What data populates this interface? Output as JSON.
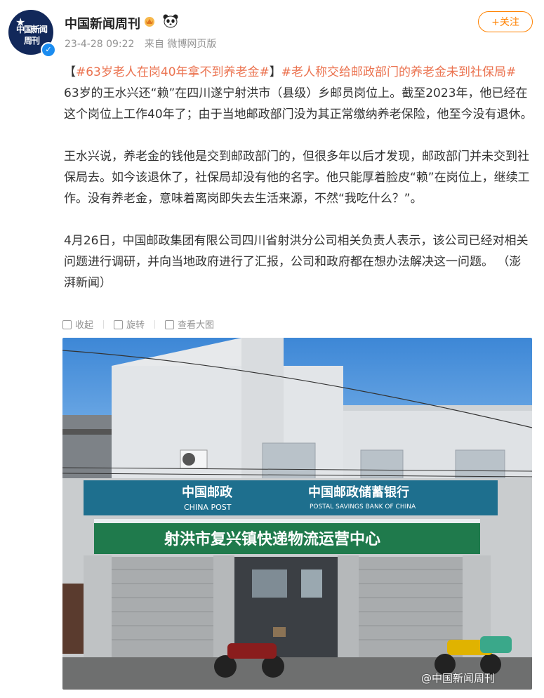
{
  "account": {
    "name": "中国新闻周刊",
    "avatar_text": "中国新闻周刊",
    "verified_icon": "verified-badge-icon"
  },
  "post_meta": {
    "date": "23-4-28 09:22",
    "source": "来自 微博网页版"
  },
  "follow_label": "+关注",
  "post": {
    "tag1": "#63岁老人在岗40年拿不到养老金#",
    "tag2": "#老人称交给邮政部门的养老金未到社保局#",
    "p1": " 63岁的王水兴还“赖”在四川遂宁射洪市（县级）乡邮员岗位上。截至2023年，他已经在这个岗位上工作40年了；由于当地邮政部门没为其正常缴纳养老保险，他至今没有退休。",
    "p2": "王水兴说，养老金的钱他是交到邮政部门的，但很多年以后才发现，邮政部门并未交到社保局去。如今该退休了，社保局却没有他的名字。他只能厚着脸皮“赖”在岗位上，继续工作。没有养老金，意味着离岗即失去生活来源，不然“我吃什么？”。",
    "p3": "4月26日，中国邮政集团有限公司四川省射洪分公司相关负责人表示，该公司已经对相关问题进行调研，并向当地政府进行了汇报，公司和政府都在想办法解决这一问题。 （澎湃新闻）"
  },
  "tools": {
    "collapse": "收起",
    "rotate": "旋转",
    "view_large": "查看大图"
  },
  "photo": {
    "sign_post_cn": "中国邮政",
    "sign_post_en": "CHINA POST",
    "sign_bank_cn": "中国邮政储蓄银行",
    "sign_bank_en": "POSTAL SAVINGS BANK OF CHINA",
    "sign_center": "射洪市复兴镇快递物流运营中心",
    "watermark": "@中国新闻周刊"
  },
  "colors": {
    "tag": "#eb7350",
    "follow": "#ff8200",
    "post_green": "#1f7a4c"
  }
}
